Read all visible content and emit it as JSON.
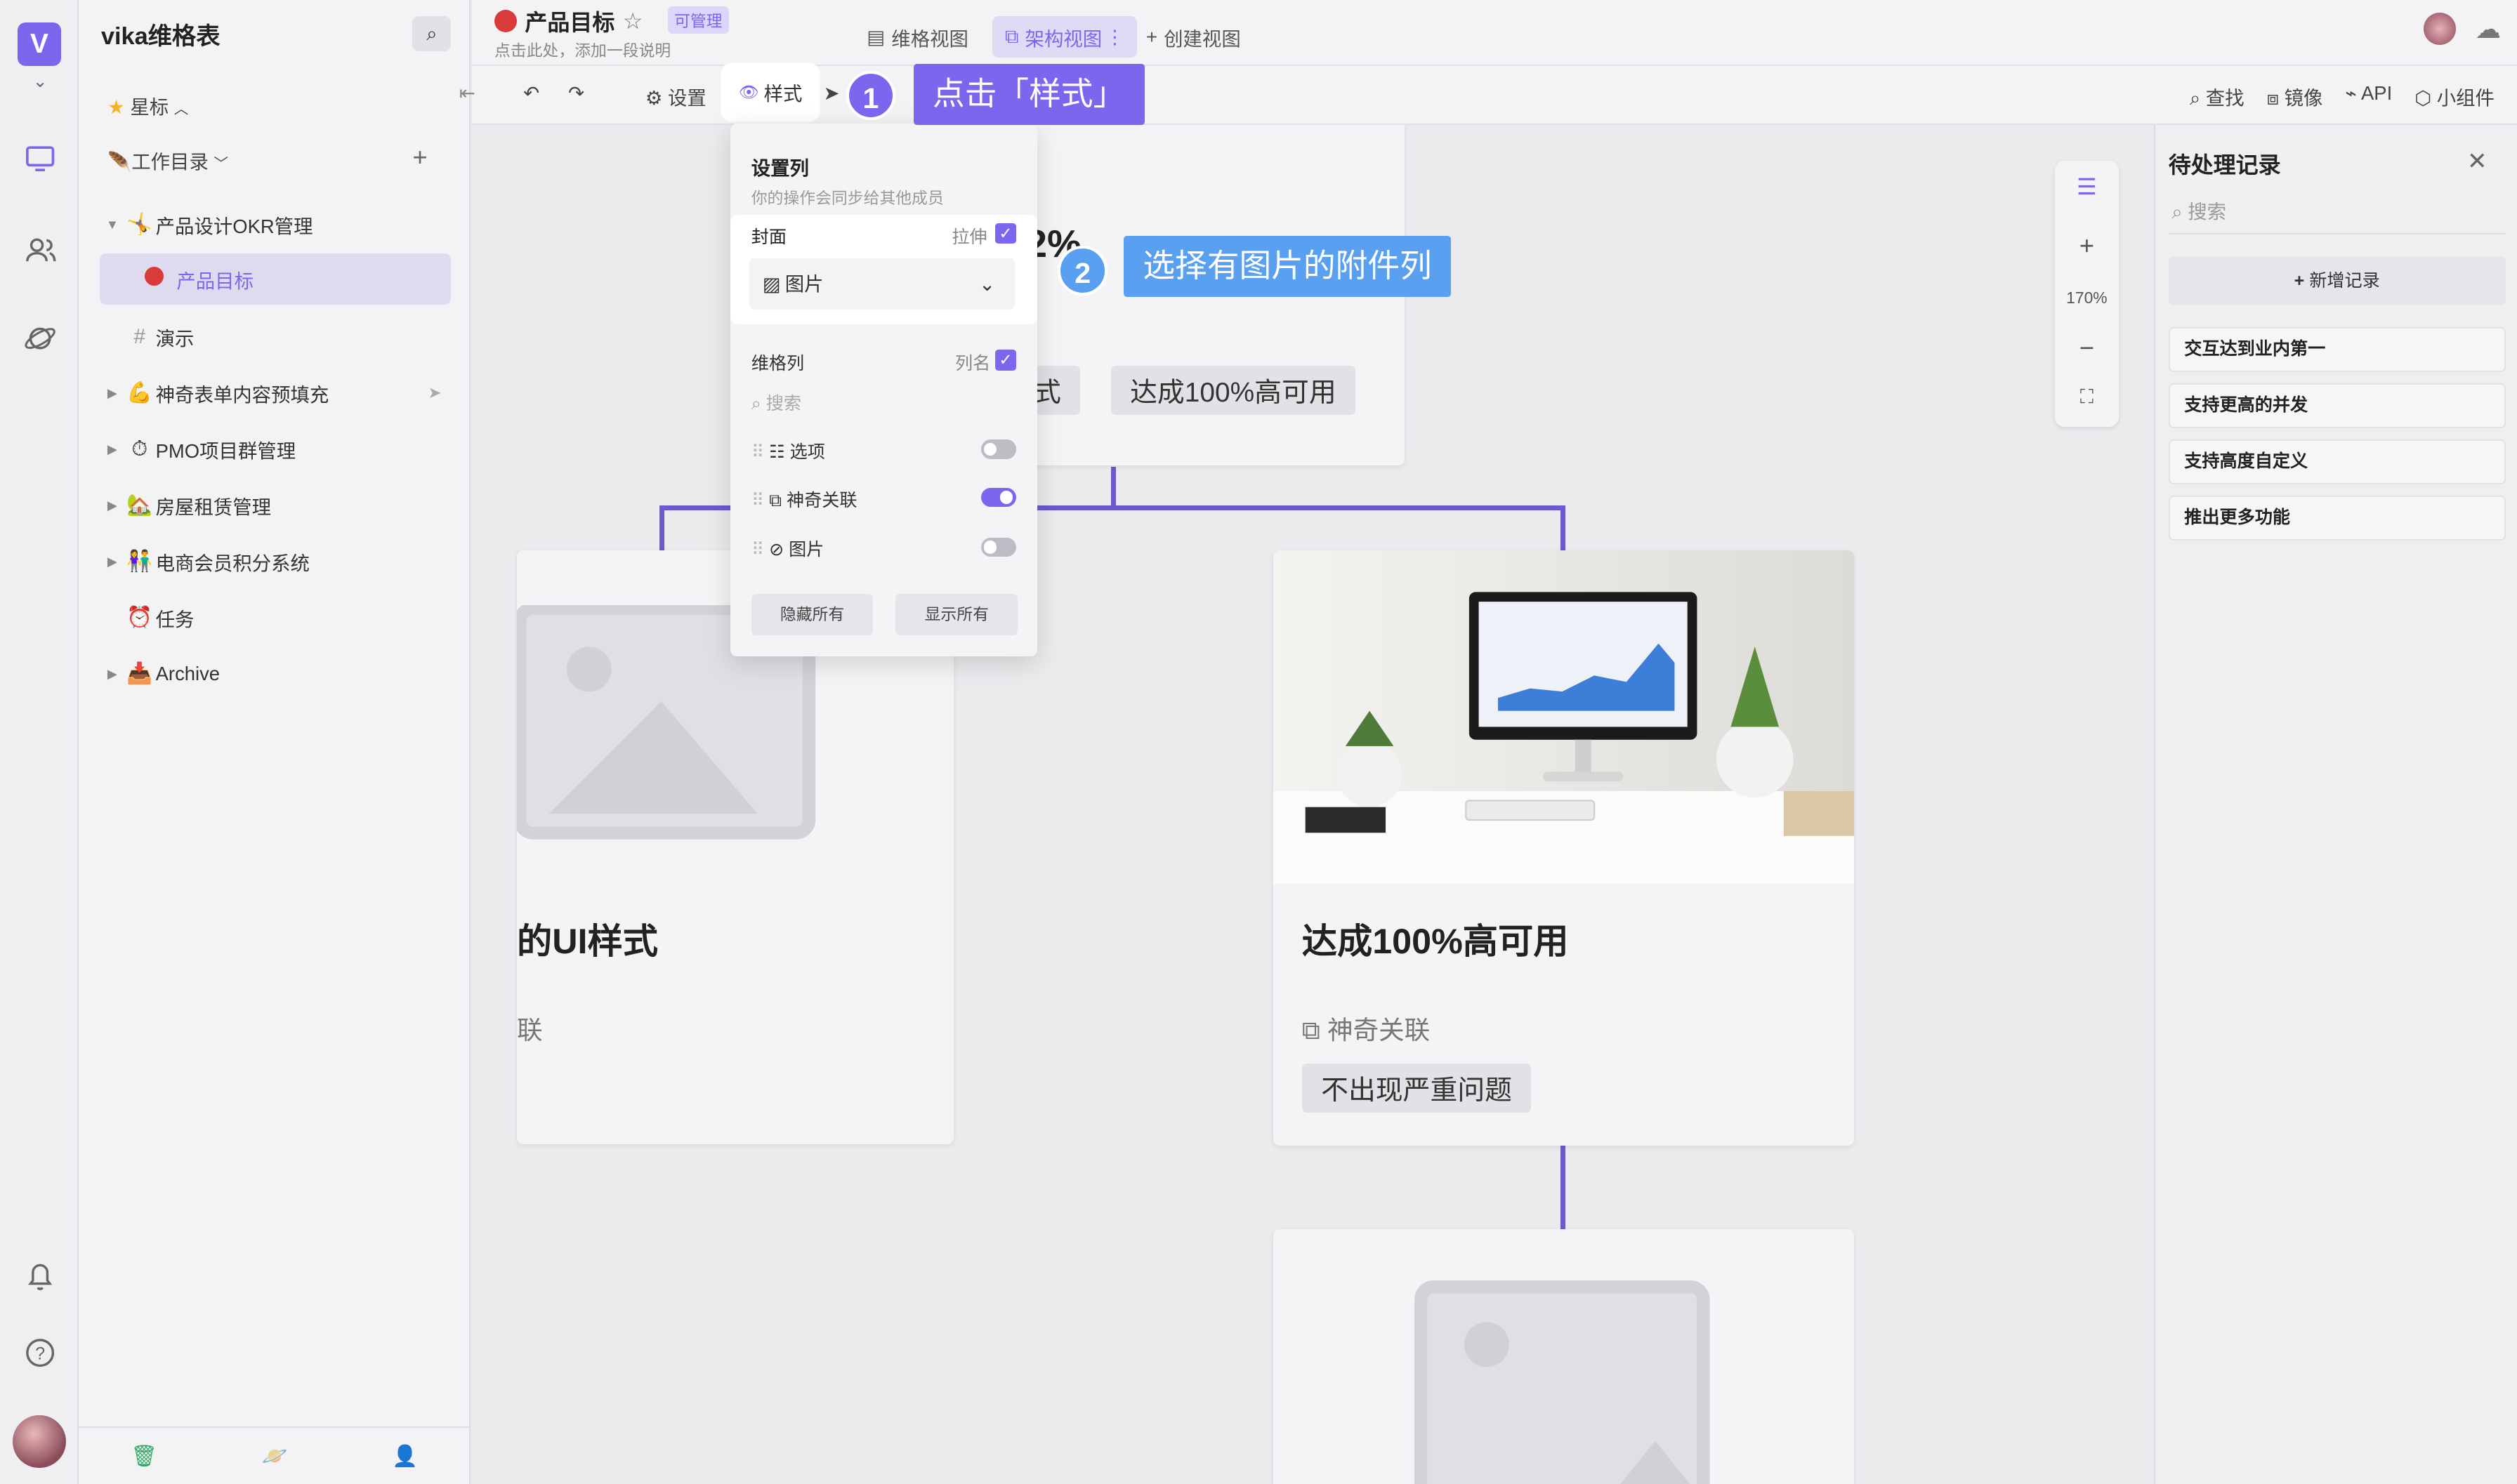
{
  "workspace": {
    "title": "vika维格表",
    "starred_label": "星标",
    "catalog_label": "工作目录"
  },
  "tree": [
    {
      "label": "产品设计OKR管理",
      "emoji": "🤸",
      "arrow": "▼"
    },
    {
      "label": "产品目标",
      "emoji": "🔴",
      "arrow": ""
    },
    {
      "label": "演示",
      "emoji": "#",
      "arrow": ""
    },
    {
      "label": "神奇表单内容预填充",
      "emoji": "💪",
      "arrow": "▶"
    },
    {
      "label": "PMO项目群管理",
      "emoji": "⏱",
      "arrow": "▶"
    },
    {
      "label": "房屋租赁管理",
      "emoji": "🏡",
      "arrow": "▶"
    },
    {
      "label": "电商会员积分系统",
      "emoji": "👫",
      "arrow": "▶"
    },
    {
      "label": "任务",
      "emoji": "⏰",
      "arrow": ""
    },
    {
      "label": "Archive",
      "emoji": "📥",
      "arrow": "▶"
    }
  ],
  "header": {
    "datasheet_name": "产品目标",
    "permission_badge": "可管理",
    "description": "点击此处，添加一段说明",
    "tabs": [
      "维格视图",
      "架构视图",
      "创建视图"
    ]
  },
  "toolbar": {
    "settings": "设置",
    "style": "样式",
    "right_items": [
      "查找",
      "镜像",
      "API",
      "小组件"
    ]
  },
  "canvas": {
    "card_left_title": "的UI样式",
    "card_left_field": "联",
    "card_top_tag_a": "式",
    "card_top_tag_b": "达成100%高可用",
    "card_top_title_partial": "2%",
    "card_main_title": "达成100%高可用",
    "card_main_field": "神奇关联",
    "card_main_tag": "不出现严重问题",
    "zoom_level": "170%"
  },
  "popup": {
    "heading": "设置列",
    "subtext": "你的操作会同步给其他成员",
    "cover_label": "封面",
    "stretch_label": "拉伸",
    "cover_field": "图片",
    "columns_label": "维格列",
    "column_name_label": "列名",
    "search_placeholder": "搜索",
    "fields": [
      {
        "name": "选项",
        "on": false
      },
      {
        "name": "神奇关联",
        "on": true
      },
      {
        "name": "图片",
        "on": false
      }
    ],
    "hide_all": "隐藏所有",
    "show_all": "显示所有"
  },
  "tutorial": {
    "step1_num": "1",
    "step1_text": "点击「样式」",
    "step2_num": "2",
    "step2_text": "选择有图片的附件列"
  },
  "right_panel": {
    "title": "待处理记录",
    "search_placeholder": "搜索",
    "add_record": "新增记录",
    "records": [
      "交互达到业内第一",
      "支持更高的并发",
      "支持高度自定义",
      "推出更多功能"
    ]
  },
  "colors": {
    "accent": "#7b67ee",
    "callout_blue": "#5aa0f0",
    "tree_line": "#6a5acd"
  }
}
